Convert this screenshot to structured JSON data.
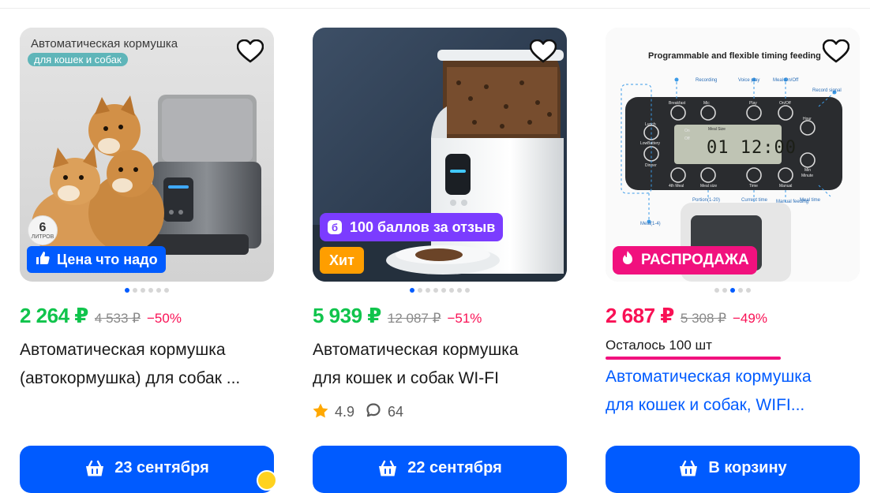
{
  "products": [
    {
      "image_text": {
        "headline": "Автоматическая кормушка",
        "pill": "для кошек и собак",
        "volume_number": "6",
        "volume_unit": "литров"
      },
      "badge": "Цена что надо",
      "price": "2 264 ₽",
      "old_price": "4 533 ₽",
      "discount": "−50%",
      "title_line1": "Автоматическая кормушка",
      "title_line2": "(автокормушка) для собак ...",
      "button_label": "23 сентября"
    },
    {
      "badge_points": "100 баллов за отзыв",
      "badge_hit": "Хит",
      "price": "5 939 ₽",
      "old_price": "12 087 ₽",
      "discount": "−51%",
      "title_line1": "Автоматическая кормушка",
      "title_line2": "для кошек и собак WI-FI",
      "rating": "4.9",
      "reviews": "64",
      "button_label": "22 сентября"
    },
    {
      "image_text": {
        "headline": "Programmable and flexible timing feeding",
        "labels": [
          "Recording",
          "Voice play",
          "Meal On/Off",
          "Record signal",
          "Breakfast",
          "Mic",
          "Play",
          "On/Off",
          "Hour",
          "Lunch",
          "LowBattery",
          "Dinner",
          "Meal Size",
          "On",
          "Off",
          "Min",
          "Minute",
          "4th Meal",
          "Meal size",
          "Time",
          "Manual",
          "Portion(1-20)",
          "Current time",
          "Manual feeding",
          "Meal time",
          "Meal(1-4)"
        ],
        "display": "01 12:00"
      },
      "badge": "РАСПРОДАЖА",
      "price": "2 687 ₽",
      "old_price": "5 308 ₽",
      "discount": "−49%",
      "remaining": "Осталось 100 шт",
      "title_line1": "Автоматическая кормушка",
      "title_line2": "для кошек и собак, WIFI...",
      "button_label": "В корзину"
    }
  ],
  "colors": {
    "brand_blue": "#005bff",
    "price_green": "#10c44c",
    "price_pink": "#f91155",
    "discount_red": "#f91155",
    "badge_blue": "#005bff",
    "badge_purple": "#7b3cff",
    "badge_orange": "#ff9e00",
    "badge_sale": "#f1117e",
    "star": "#ffa800"
  }
}
